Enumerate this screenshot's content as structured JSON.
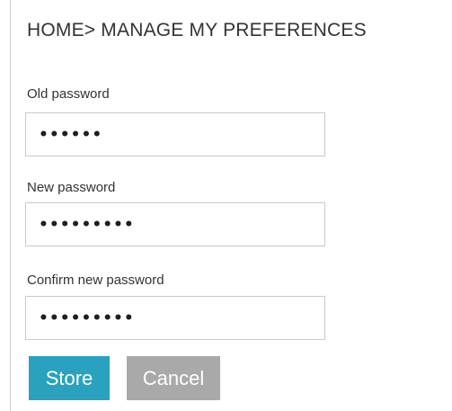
{
  "breadcrumb": {
    "text": "HOME> MANAGE MY PREFERENCES"
  },
  "form": {
    "old_password": {
      "label": "Old password",
      "masked_value": "••••••"
    },
    "new_password": {
      "label": "New password",
      "masked_value": "•••••••••"
    },
    "confirm_password": {
      "label": "Confirm new password",
      "masked_value": "•••••••••"
    }
  },
  "actions": {
    "store_label": "Store",
    "cancel_label": "Cancel"
  },
  "colors": {
    "store_button": "#2aa1bf",
    "cancel_button": "#a9a9a9",
    "field_border": "#c9c9c9"
  }
}
